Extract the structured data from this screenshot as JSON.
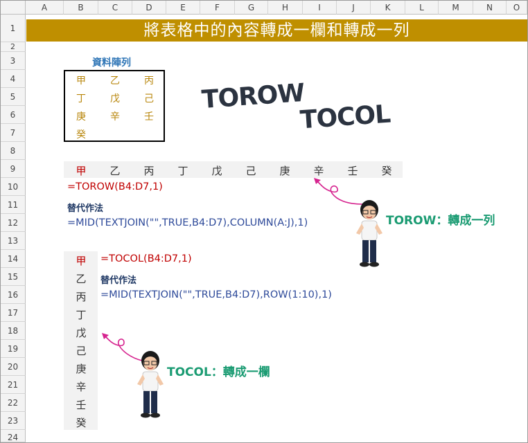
{
  "columns": [
    "A",
    "B",
    "C",
    "D",
    "E",
    "F",
    "G",
    "H",
    "I",
    "J",
    "K",
    "L",
    "M",
    "N",
    "O"
  ],
  "rows": [
    "1",
    "2",
    "3",
    "4",
    "5",
    "6",
    "7",
    "8",
    "9",
    "10",
    "11",
    "12",
    "13",
    "14",
    "15",
    "16",
    "17",
    "18",
    "19",
    "20",
    "21",
    "22",
    "23",
    "24"
  ],
  "banner": "將表格中的內容轉成一欄和轉成一列",
  "array_title": "資料陣列",
  "array_cells": [
    [
      "甲",
      "乙",
      "丙"
    ],
    [
      "丁",
      "戊",
      "己"
    ],
    [
      "庚",
      "辛",
      "壬"
    ],
    [
      "癸",
      "",
      ""
    ]
  ],
  "torow_word": "TOROW",
  "tocol_word": "TOCOL",
  "row_result": [
    "甲",
    "乙",
    "丙",
    "丁",
    "戊",
    "己",
    "庚",
    "辛",
    "壬",
    "癸"
  ],
  "col_result": [
    "甲",
    "乙",
    "丙",
    "丁",
    "戊",
    "己",
    "庚",
    "辛",
    "壬",
    "癸"
  ],
  "formula_torow": "=TOROW(B4:D7,1)",
  "alt_label_1": "替代作法",
  "formula_torow_alt": "=MID(TEXTJOIN(\"\",TRUE,B4:D7),COLUMN(A:J),1)",
  "formula_tocol": "=TOCOL(B4:D7,1)",
  "alt_label_2": "替代作法",
  "formula_tocol_alt": "=MID(TEXTJOIN(\"\",TRUE,B4:D7),ROW(1:10),1)",
  "callout_torow": "TOROW：轉成一列",
  "callout_tocol": "TOCOL：轉成一欄",
  "colors": {
    "banner": "#bf8f00",
    "array_text": "#b8860b",
    "formula_red": "#c00000",
    "formula_blue": "#2e4a9a",
    "callout": "#1a9b72",
    "arrow": "#d6248f"
  }
}
